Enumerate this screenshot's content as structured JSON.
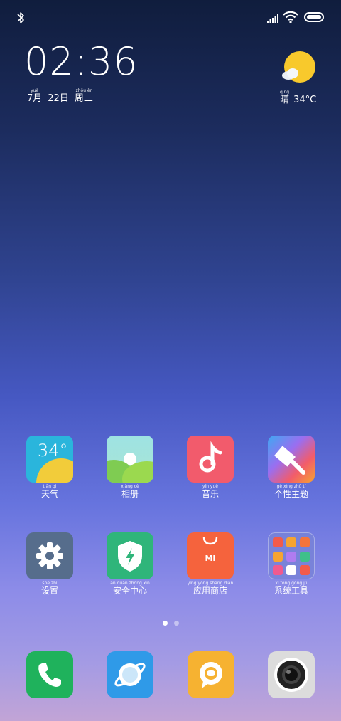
{
  "status_bar": {
    "bluetooth_icon": "bluetooth-icon",
    "signal_icon": "signal-bars-icon",
    "wifi_icon": "wifi-icon",
    "battery_icon": "battery-icon"
  },
  "clock": {
    "time": "02:36",
    "date": [
      {
        "py": "yuè",
        "hz": "7月"
      },
      {
        "py": "",
        "hz": "22日"
      },
      {
        "py": "zhōu èr",
        "hz": "周二"
      }
    ]
  },
  "weather": {
    "icon": "sunny-partly-cloudy-icon",
    "condition_py": "qíng",
    "condition": "晴",
    "temperature": "34°C"
  },
  "apps_row1": [
    {
      "name": "weather",
      "label": "天气",
      "py": "tiān qì",
      "tile_text": "34°",
      "color": "#29b6d8"
    },
    {
      "name": "gallery",
      "label": "相册",
      "py": "xiàng cè",
      "color": "#8fd3a0"
    },
    {
      "name": "music",
      "label": "音乐",
      "py": "yīn yuè",
      "color": "#f0546a"
    },
    {
      "name": "themes",
      "label": "个性主题",
      "py": "gè xìng zhǔ tí",
      "color": "#f27a3a"
    }
  ],
  "apps_row2": [
    {
      "name": "settings",
      "label": "设置",
      "py": "shè zhì",
      "color": "#566d8c"
    },
    {
      "name": "security",
      "label": "安全中心",
      "py": "ān quán zhōng xīn",
      "color": "#2fb57a"
    },
    {
      "name": "app-store",
      "label": "应用商店",
      "py": "yìng yòng shāng diàn",
      "tile_text": "MI",
      "color": "#f5633d"
    },
    {
      "name": "system-tools",
      "label": "系统工具",
      "py": "xì tǒng gōng jù",
      "color": "#6a78d6"
    }
  ],
  "pager": {
    "pages": 2,
    "current": 1
  },
  "dock": [
    {
      "name": "phone",
      "color": "#1fb25c"
    },
    {
      "name": "browser",
      "color": "#2f9ae8"
    },
    {
      "name": "messages",
      "color": "#f6b231"
    },
    {
      "name": "camera",
      "color": "#dcdcdc"
    }
  ]
}
